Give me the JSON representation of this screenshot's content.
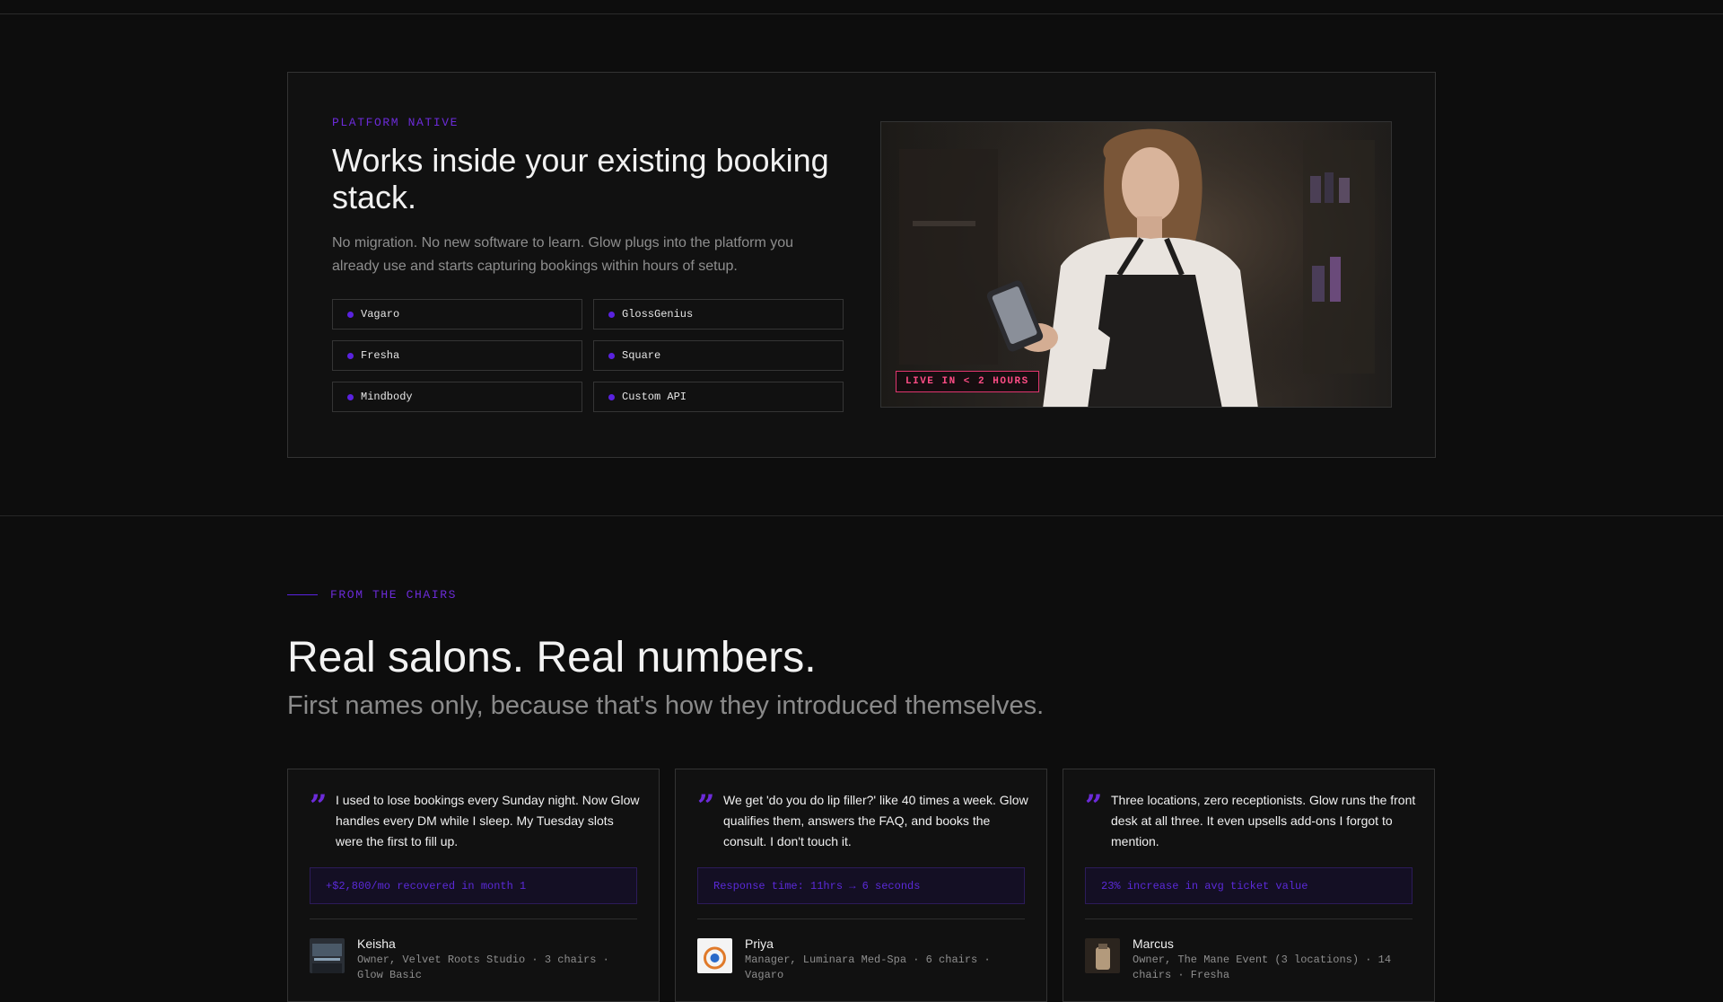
{
  "platform": {
    "eyebrow": "PLATFORM NATIVE",
    "title": "Works inside your existing booking stack.",
    "description": "No migration. No new software to learn. Glow plugs into the platform you already use and starts capturing bookings within hours of setup.",
    "integrations": [
      "Vagaro",
      "GlossGenius",
      "Fresha",
      "Square",
      "Mindbody",
      "Custom API"
    ],
    "badge": "LIVE IN < 2 HOURS"
  },
  "testimonials_section": {
    "eyebrow": "FROM THE CHAIRS",
    "title": "Real salons. Real numbers.",
    "subtitle": "First names only, because that's how they introduced themselves.",
    "items": [
      {
        "quote": "I used to lose bookings every Sunday night. Now Glow handles every DM while I sleep. My Tuesday slots were the first to fill up.",
        "metric": "+$2,800/mo recovered in month 1",
        "name": "Keisha",
        "role": "Owner, Velvet Roots Studio · 3 chairs · Glow Basic"
      },
      {
        "quote": "We get 'do you do lip filler?' like 40 times a week. Glow qualifies them, answers the FAQ, and books the consult. I don't touch it.",
        "metric": "Response time: 11hrs → 6 seconds",
        "name": "Priya",
        "role": "Manager, Luminara Med-Spa · 6 chairs · Vagaro"
      },
      {
        "quote": "Three locations, zero receptionists. Glow runs the front desk at all three. It even upsells add-ons I forgot to mention.",
        "metric": "23% increase in avg ticket value",
        "name": "Marcus",
        "role": "Owner, The Mane Event (3 locations) · 14 chairs · Fresha"
      }
    ]
  },
  "colors": {
    "accent": "#6c2bd9",
    "badge": "#ff4d86",
    "background": "#0d0d0d"
  },
  "icons": {
    "quote": "quote-icon",
    "bullet": "dot-icon"
  },
  "quote_glyph": "”"
}
